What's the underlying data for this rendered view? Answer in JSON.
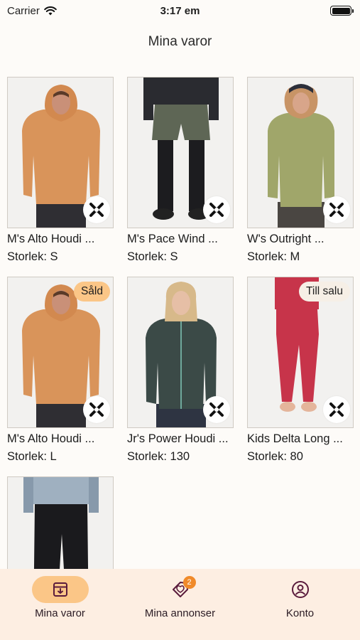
{
  "status_bar": {
    "carrier": "Carrier",
    "time": "3:17 em"
  },
  "header": {
    "title": "Mina varor"
  },
  "products": [
    {
      "name": "M's Alto Houdi ...",
      "size": "Storlek: S",
      "status": ""
    },
    {
      "name": "M's Pace Wind ...",
      "size": "Storlek: S",
      "status": ""
    },
    {
      "name": "W's Outright ...",
      "size": "Storlek: M",
      "status": ""
    },
    {
      "name": "M's Alto Houdi ...",
      "size": "Storlek: L",
      "status": "Såld"
    },
    {
      "name": "Jr's Power Houdi ...",
      "size": "Storlek: 130",
      "status": ""
    },
    {
      "name": "Kids Delta Long ...",
      "size": "Storlek: 80",
      "status": "Till salu"
    },
    {
      "name": "",
      "size": "",
      "status": ""
    }
  ],
  "bottom_nav": {
    "items": [
      {
        "label": "Mina varor",
        "icon": "archive-box-icon",
        "active": true
      },
      {
        "label": "Mina annonser",
        "icon": "tag-icon",
        "badge": "2"
      },
      {
        "label": "Konto",
        "icon": "user-circle-icon"
      }
    ]
  },
  "colors": {
    "accent": "#fbc687",
    "nav_background": "#fdeee2",
    "badge": "#f08a2a",
    "icon_dark": "#5a1b3c"
  }
}
